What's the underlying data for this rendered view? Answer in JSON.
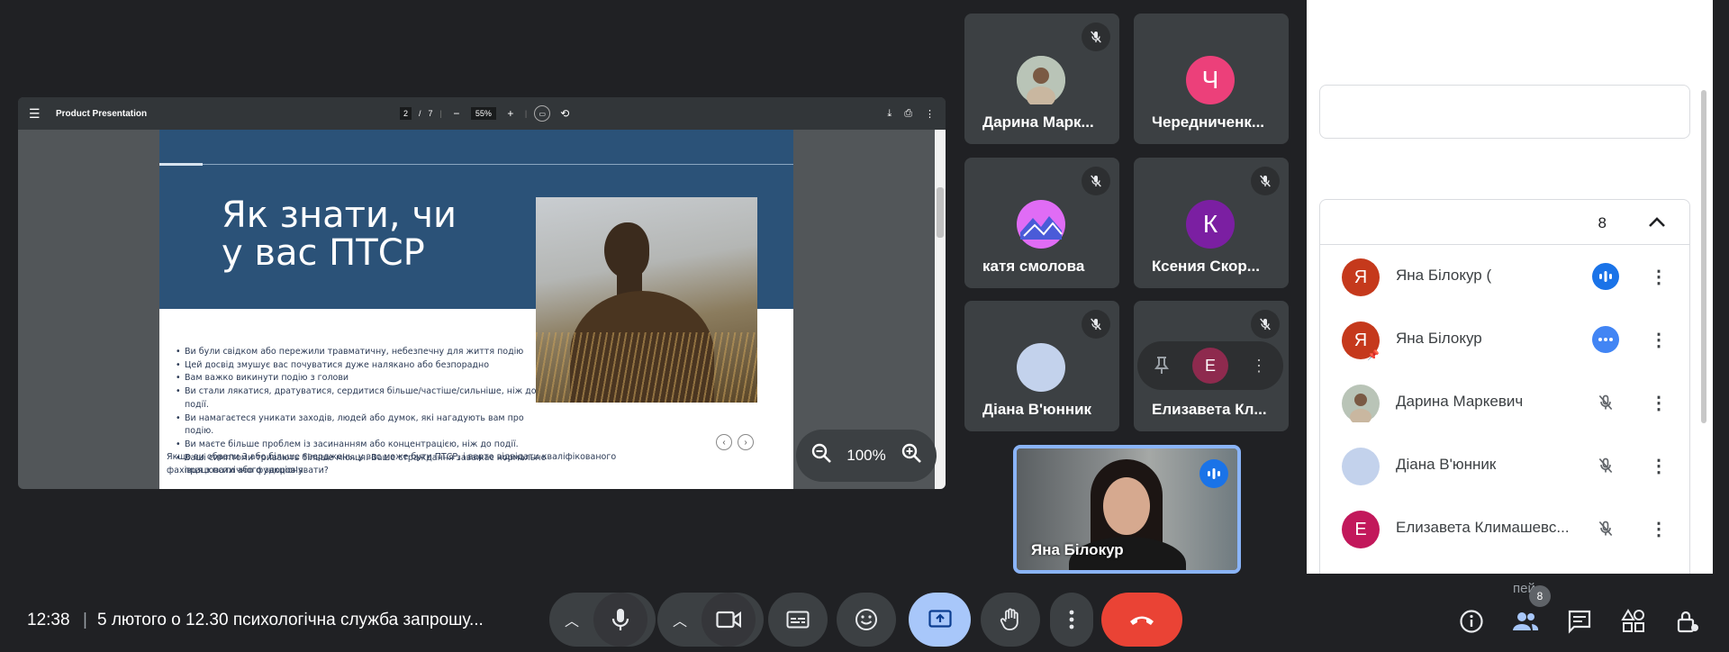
{
  "presentation": {
    "title": "Product Presentation",
    "page_current": "2",
    "page_total": "7",
    "zoom": "55%",
    "page_sep": "/",
    "slide": {
      "title_line1": "Як знати, чи",
      "title_line2": "у вас ПТСР",
      "bullets": [
        "Ви були свідком або пережили травматичну, небезпечну для життя подію",
        "Цей досвід змушує вас почуватися дуже налякано або безпорадно",
        "Вам важко викинути подію з голови",
        "Ви стали лякатися, дратуватися, сердитися більше/частіше/сильніше, ніж до події.",
        "Ви намагаєтеся уникати заходів, людей або думок, які нагадують вам про подію.",
        "Ви маєте більше проблем із засинанням або концентрацією, ніж до події.",
        "Ваші симптоми тривають більше місяця. Ваше страждання заважає нормально працювати або функціонувати?"
      ],
      "footer": "Якщо ви обрали 3 або більше тверджень, у вас може бути ПТСР, і варто відвідати кваліфікованого фахівця з психічного здоров'я."
    },
    "zoom_control": "100%"
  },
  "tiles": [
    {
      "name": "Дарина Марк...",
      "avatar_letter": "",
      "avatar_color": "#9bb0a0"
    },
    {
      "name": "Чередниченк...",
      "avatar_letter": "Ч",
      "avatar_color": "#ec407a"
    },
    {
      "name": "катя смолова",
      "avatar_letter": "",
      "avatar_color": "#c77dff"
    },
    {
      "name": "Ксения Скор...",
      "avatar_letter": "К",
      "avatar_color": "#7b1fa2"
    },
    {
      "name": "Діана В'юнник",
      "avatar_letter": "",
      "avatar_color": "#c3d2ec"
    },
    {
      "name": "Елизавета Кл...",
      "avatar_letter": "Е",
      "avatar_color": "#c2185b"
    }
  ],
  "self_tile": {
    "name": "Яна Білокур"
  },
  "panel": {
    "count": "8",
    "participants": [
      {
        "name": "Яна Білокур (",
        "letter": "Я",
        "color": "#c5391c",
        "status": "speaking"
      },
      {
        "name": "Яна Білокур",
        "letter": "Я",
        "color": "#c5391c",
        "status": "more"
      },
      {
        "name": "Дарина Маркевич",
        "letter": "",
        "color": "#9bb0a0",
        "status": "muted"
      },
      {
        "name": "Діана В'юнник",
        "letter": "",
        "color": "#c3d2ec",
        "status": "muted"
      },
      {
        "name": "Елизавета Климашевс...",
        "letter": "Е",
        "color": "#c2185b",
        "status": "muted"
      }
    ],
    "faded_label": "пей"
  },
  "bottom": {
    "time": "12:38",
    "separator": "|",
    "meeting_title": "5 лютого о 12.30 психологічна служба запрошу...",
    "people_count": "8"
  },
  "colors": {
    "accent": "#8ab4f8",
    "end_call": "#ea4335",
    "active_control": "#a8c7fa"
  }
}
